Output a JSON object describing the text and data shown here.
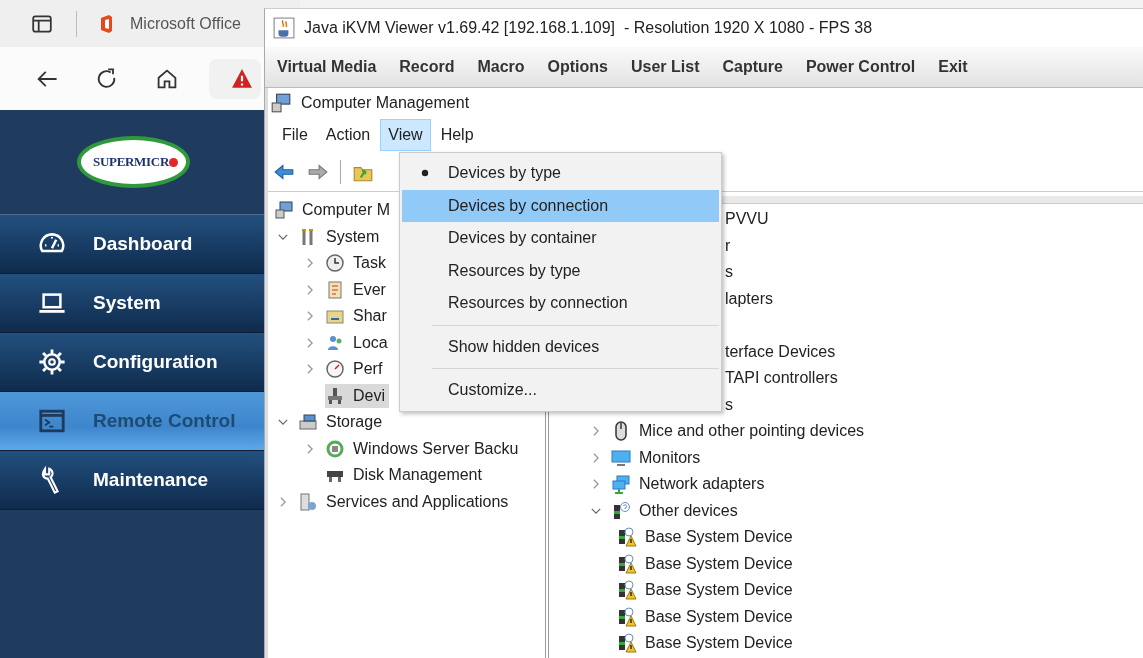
{
  "browser": {
    "tab": {
      "title": "Microsoft Office"
    },
    "logo": {
      "text": "SUPERMICR"
    },
    "sidebar": {
      "items": [
        {
          "label": "Dashboard",
          "kind": "gauge",
          "selected": false
        },
        {
          "label": "System",
          "kind": "laptop",
          "selected": false
        },
        {
          "label": "Configuration",
          "kind": "gear",
          "selected": false
        },
        {
          "label": "Remote Control",
          "kind": "terminal",
          "selected": true
        },
        {
          "label": "Maintenance",
          "kind": "wrench",
          "selected": false
        }
      ]
    }
  },
  "kvm_window": {
    "title": "Java iKVM Viewer v1.69.42 [192.168.1.109]  - Resolution 1920 X 1080 - FPS 38",
    "menu": [
      "Virtual Media",
      "Record",
      "Macro",
      "Options",
      "User List",
      "Capture",
      "Power Control",
      "Exit"
    ]
  },
  "computer_management": {
    "title": "Computer Management",
    "menu": [
      {
        "label": "File",
        "selected": false
      },
      {
        "label": "Action",
        "selected": false
      },
      {
        "label": "View",
        "selected": true
      },
      {
        "label": "Help",
        "selected": false
      }
    ],
    "view_menu": [
      {
        "kind": "item",
        "label": "Devices by type",
        "checked": true,
        "highlighted": false
      },
      {
        "kind": "item",
        "label": "Devices by connection",
        "checked": false,
        "highlighted": true
      },
      {
        "kind": "item",
        "label": "Devices by container",
        "checked": false,
        "highlighted": false
      },
      {
        "kind": "item",
        "label": "Resources by type",
        "checked": false,
        "highlighted": false
      },
      {
        "kind": "item",
        "label": "Resources by connection",
        "checked": false,
        "highlighted": false
      },
      {
        "kind": "separator"
      },
      {
        "kind": "item",
        "label": "Show hidden devices",
        "checked": false,
        "highlighted": false
      },
      {
        "kind": "separator"
      },
      {
        "kind": "item",
        "label": "Customize...",
        "checked": false,
        "highlighted": false
      }
    ],
    "tree": [
      {
        "label": "Computer M",
        "kind": "computer",
        "selected": false,
        "children": [
          {
            "label": "System",
            "kind": "tools",
            "expanded": true,
            "selected": false,
            "children": [
              {
                "label": "Task",
                "kind": "clock",
                "expanded": false,
                "selected": false
              },
              {
                "label": "Ever",
                "kind": "log",
                "expanded": false,
                "selected": false
              },
              {
                "label": "Shar",
                "kind": "share",
                "expanded": false,
                "selected": false
              },
              {
                "label": "Loca",
                "kind": "users",
                "expanded": false,
                "selected": false
              },
              {
                "label": "Perf",
                "kind": "perf",
                "expanded": false,
                "selected": false
              },
              {
                "label": "Devi",
                "kind": "device",
                "selected": true
              }
            ]
          },
          {
            "label": "Storage",
            "kind": "storage",
            "expanded": true,
            "selected": false,
            "children": [
              {
                "label": "Windows Server Backu",
                "kind": "backup",
                "expanded": false,
                "selected": false
              },
              {
                "label": "Disk Management",
                "kind": "disk",
                "selected": false
              }
            ]
          },
          {
            "label": "Services and Applications",
            "kind": "services",
            "expanded": false,
            "selected": false
          }
        ]
      }
    ],
    "devices": [
      {
        "kind": "partial",
        "label": "PVVU",
        "children": [
          {
            "kind": "partial",
            "label": "r"
          },
          {
            "kind": "partial",
            "label": "s"
          },
          {
            "kind": "partial",
            "label": "lapters"
          },
          {
            "kind": "covered"
          },
          {
            "kind": "partial",
            "label": "terface Devices"
          },
          {
            "kind": "partial",
            "label": "TAPI controllers"
          },
          {
            "kind": "partial",
            "label": "s"
          },
          {
            "kind": "mouse",
            "label": "Mice and other pointing devices",
            "expanded": false
          },
          {
            "kind": "monitor",
            "label": "Monitors",
            "expanded": false
          },
          {
            "kind": "network",
            "label": "Network adapters",
            "expanded": false
          },
          {
            "kind": "unknown",
            "label": "Other devices",
            "expanded": true,
            "children": [
              {
                "kind": "warndev",
                "label": "Base System Device"
              },
              {
                "kind": "warndev",
                "label": "Base System Device"
              },
              {
                "kind": "warndev",
                "label": "Base System Device"
              },
              {
                "kind": "warndev",
                "label": "Base System Device"
              },
              {
                "kind": "warndev",
                "label": "Base System Device"
              }
            ]
          }
        ]
      }
    ]
  }
}
